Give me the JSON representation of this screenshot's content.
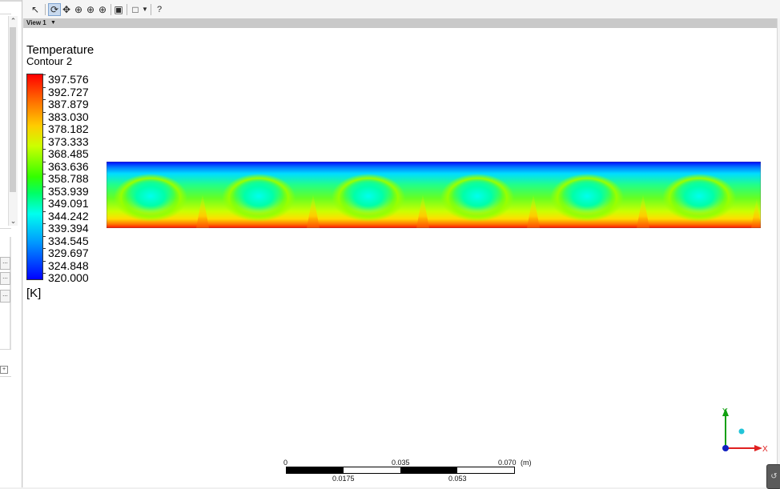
{
  "toolbar": {
    "icons": [
      "select-icon",
      "rotate-icon",
      "pan-icon",
      "zoom-icon",
      "zoom-box-icon",
      "zoom-fit-icon",
      "zoom-to-icon",
      "view-cube-icon",
      "viewport-layout-icon",
      "help-icon"
    ]
  },
  "view": {
    "tab_label": "View 1"
  },
  "legend": {
    "title": "Temperature",
    "subtitle": "Contour 2",
    "unit": "[K]",
    "values": [
      "397.576",
      "392.727",
      "387.879",
      "383.030",
      "378.182",
      "373.333",
      "368.485",
      "363.636",
      "358.788",
      "353.939",
      "349.091",
      "344.242",
      "339.394",
      "334.545",
      "329.697",
      "324.848",
      "320.000"
    ]
  },
  "scale": {
    "top": {
      "zero": "0",
      "mid": "0.035",
      "end": "0.070",
      "unit": "(m)"
    },
    "bottom": {
      "first": "0.0175",
      "second": "0.053"
    }
  },
  "axes": {
    "y": "Y",
    "x": "X"
  },
  "left_panel": {
    "button": "..."
  },
  "colors": {
    "accent": "#c8d9ee",
    "hot": "#ff0000",
    "cold": "#0000ff"
  }
}
